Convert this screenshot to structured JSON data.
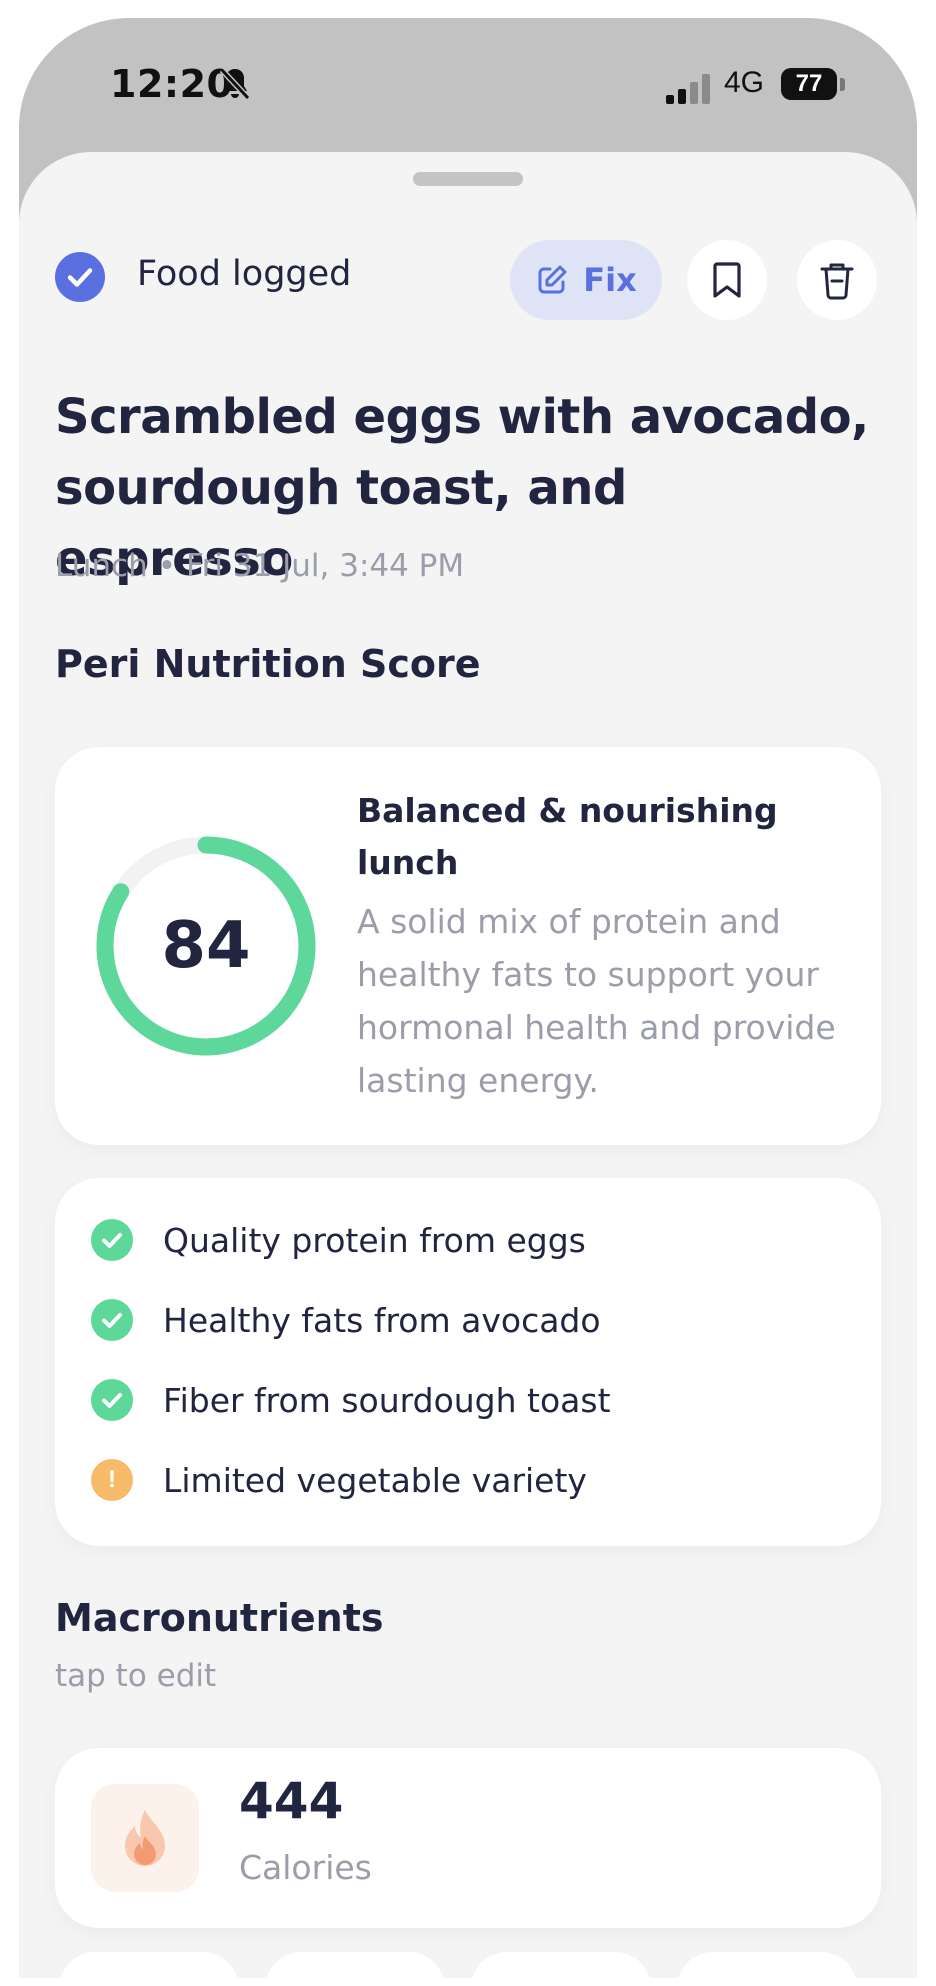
{
  "status_bar": {
    "time": "12:20",
    "network": "4G",
    "battery": "77"
  },
  "header": {
    "logged_label": "Food logged",
    "fix_label": "Fix",
    "bookmark_icon": "bookmark-icon",
    "trash_icon": "trash-icon"
  },
  "meal": {
    "title": "Scrambled eggs with avocado, sourdough toast, and espresso",
    "meal_type": "Lunch",
    "separator": "•",
    "datetime": "Fri 31 Jul, 3:44 PM"
  },
  "score": {
    "heading": "Peri Nutrition Score",
    "value": "84",
    "value_fraction": 0.84,
    "summary_title": "Balanced & nourishing lunch",
    "description": "A solid mix of protein and healthy fats to support your hormonal health and provide lasting energy.",
    "ring_color": "#5dd79a",
    "track_color": "#f2f2f3"
  },
  "points": [
    {
      "label": "Quality protein from eggs",
      "status": "good",
      "icon": "check-circle-icon"
    },
    {
      "label": "Healthy fats from avocado",
      "status": "good",
      "icon": "check-circle-icon"
    },
    {
      "label": "Fiber from sourdough toast",
      "status": "good",
      "icon": "check-circle-icon"
    },
    {
      "label": "Limited vegetable variety",
      "status": "warning",
      "icon": "warning-circle-icon"
    }
  ],
  "macros": {
    "heading": "Macronutrients",
    "subheading": "tap to edit",
    "calories_value": "444",
    "calories_label": "Calories",
    "calories_icon": "flame-icon"
  },
  "colors": {
    "accent": "#5a6fe0",
    "good": "#5dd79a",
    "warning": "#f6bb68",
    "muted_text": "#9b9daa",
    "primary_text": "#22253f"
  }
}
